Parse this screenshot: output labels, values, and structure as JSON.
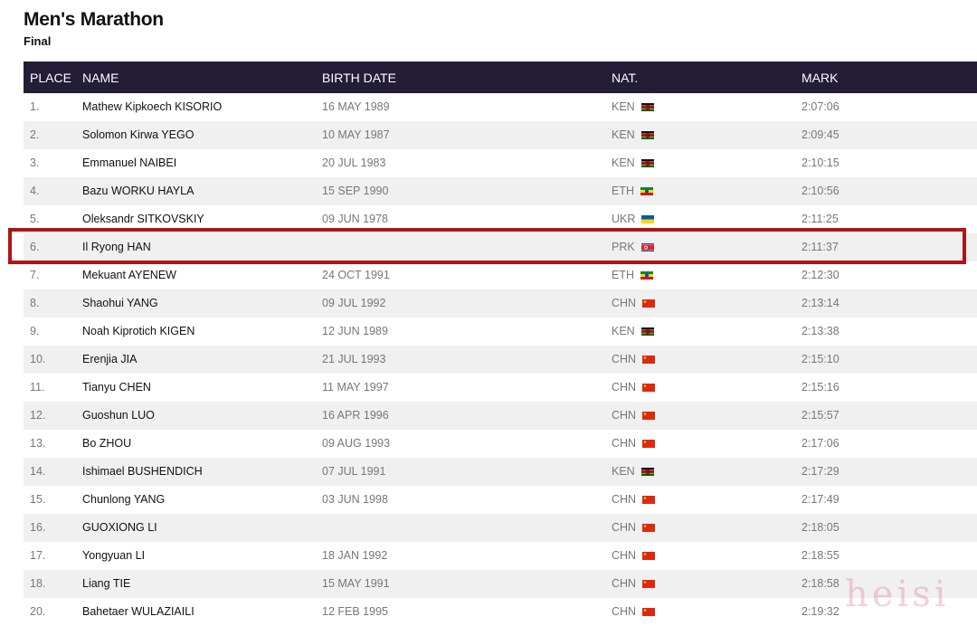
{
  "page": {
    "title": "Men's Marathon",
    "subtitle": "Final"
  },
  "columns": {
    "place": "PLACE",
    "name": "NAME",
    "birth": "BIRTH DATE",
    "nat": "NAT.",
    "mark": "MARK"
  },
  "results": [
    {
      "place": "1.",
      "name": "Mathew Kipkoech KISORIO",
      "birth": "16 MAY 1989",
      "nat": "KEN",
      "flag": "kenya-flag-icon",
      "mark": "2:07:06"
    },
    {
      "place": "2.",
      "name": "Solomon Kirwa YEGO",
      "birth": "10 MAY 1987",
      "nat": "KEN",
      "flag": "kenya-flag-icon",
      "mark": "2:09:45"
    },
    {
      "place": "3.",
      "name": "Emmanuel NAIBEI",
      "birth": "20 JUL 1983",
      "nat": "KEN",
      "flag": "kenya-flag-icon",
      "mark": "2:10:15"
    },
    {
      "place": "4.",
      "name": "Bazu WORKU HAYLA",
      "birth": "15 SEP 1990",
      "nat": "ETH",
      "flag": "ethiopia-flag-icon",
      "mark": "2:10:56"
    },
    {
      "place": "5.",
      "name": "Oleksandr SITKOVSKIY",
      "birth": "09 JUN 1978",
      "nat": "UKR",
      "flag": "ukraine-flag-icon",
      "mark": "2:11:25"
    },
    {
      "place": "6.",
      "name": "Il Ryong HAN",
      "birth": "",
      "nat": "PRK",
      "flag": "north-korea-flag-icon",
      "mark": "2:11:37",
      "highlighted": true
    },
    {
      "place": "7.",
      "name": "Mekuant AYENEW",
      "birth": "24 OCT 1991",
      "nat": "ETH",
      "flag": "ethiopia-flag-icon",
      "mark": "2:12:30"
    },
    {
      "place": "8.",
      "name": "Shaohui YANG",
      "birth": "09 JUL 1992",
      "nat": "CHN",
      "flag": "china-flag-icon",
      "mark": "2:13:14"
    },
    {
      "place": "9.",
      "name": "Noah Kiprotich KIGEN",
      "birth": "12 JUN 1989",
      "nat": "KEN",
      "flag": "kenya-flag-icon",
      "mark": "2:13:38"
    },
    {
      "place": "10.",
      "name": "Erenjia JIA",
      "birth": "21 JUL 1993",
      "nat": "CHN",
      "flag": "china-flag-icon",
      "mark": "2:15:10"
    },
    {
      "place": "11.",
      "name": "Tianyu CHEN",
      "birth": "11 MAY 1997",
      "nat": "CHN",
      "flag": "china-flag-icon",
      "mark": "2:15:16"
    },
    {
      "place": "12.",
      "name": "Guoshun LUO",
      "birth": "16 APR 1996",
      "nat": "CHN",
      "flag": "china-flag-icon",
      "mark": "2:15:57"
    },
    {
      "place": "13.",
      "name": "Bo ZHOU",
      "birth": "09 AUG 1993",
      "nat": "CHN",
      "flag": "china-flag-icon",
      "mark": "2:17:06"
    },
    {
      "place": "14.",
      "name": "Ishimael BUSHENDICH",
      "birth": "07 JUL 1991",
      "nat": "KEN",
      "flag": "kenya-flag-icon",
      "mark": "2:17:29"
    },
    {
      "place": "15.",
      "name": "Chunlong YANG",
      "birth": "03 JUN 1998",
      "nat": "CHN",
      "flag": "china-flag-icon",
      "mark": "2:17:49"
    },
    {
      "place": "16.",
      "name": "GUOXIONG LI",
      "birth": "",
      "nat": "CHN",
      "flag": "china-flag-icon",
      "mark": "2:18:05"
    },
    {
      "place": "17.",
      "name": "Yongyuan LI",
      "birth": "18 JAN 1992",
      "nat": "CHN",
      "flag": "china-flag-icon",
      "mark": "2:18:55"
    },
    {
      "place": "18.",
      "name": "Liang TIE",
      "birth": "15 MAY 1991",
      "nat": "CHN",
      "flag": "china-flag-icon",
      "mark": "2:18:58"
    },
    {
      "place": "20.",
      "name": "Bahetaer WULAZIAILI",
      "birth": "12 FEB 1995",
      "nat": "CHN",
      "flag": "china-flag-icon",
      "mark": "2:19:32"
    }
  ],
  "watermark": "heisi"
}
